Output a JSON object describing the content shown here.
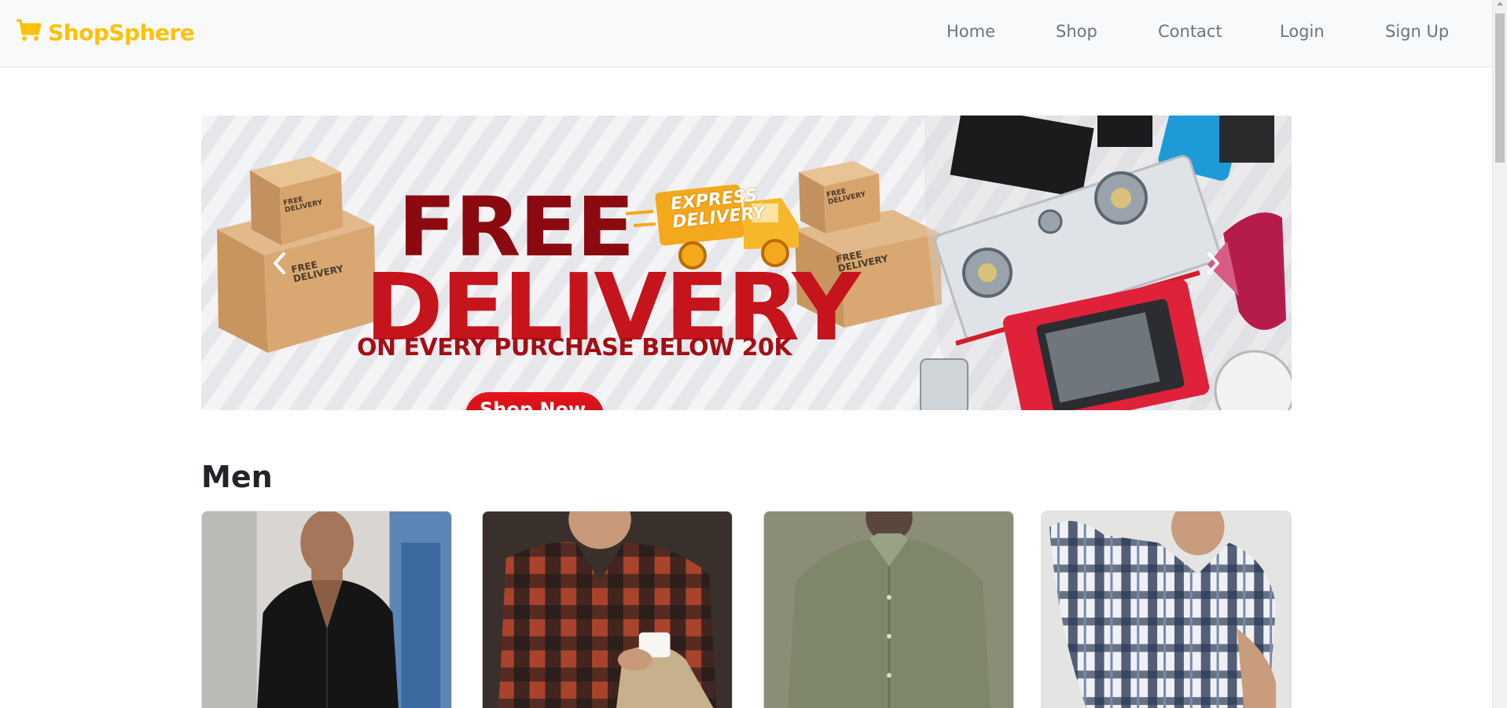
{
  "navbar": {
    "brand": "ShopSphere",
    "brand_icon": "cart-icon",
    "brand_color": "#ffc107",
    "links": [
      {
        "label": "Home"
      },
      {
        "label": "Shop"
      },
      {
        "label": "Contact"
      },
      {
        "label": "Login"
      },
      {
        "label": "Sign Up"
      }
    ]
  },
  "carousel": {
    "banner": {
      "headline_1": "FREE",
      "headline_2": "DELIVERY",
      "subline": "ON EVERY PURCHASE BELOW 20K",
      "express_badge": "EXPRESS DELIVERY",
      "box_label": "FREE DELIVERY",
      "cta": "Shop Now"
    },
    "prev_icon": "chevron-left-icon",
    "next_icon": "chevron-right-icon"
  },
  "sections": [
    {
      "title": "Men",
      "products": [
        {
          "image": "black-shirt-image"
        },
        {
          "image": "red-plaid-shirt-image"
        },
        {
          "image": "olive-shirt-image"
        },
        {
          "image": "blue-plaid-shirt-image"
        }
      ]
    }
  ]
}
